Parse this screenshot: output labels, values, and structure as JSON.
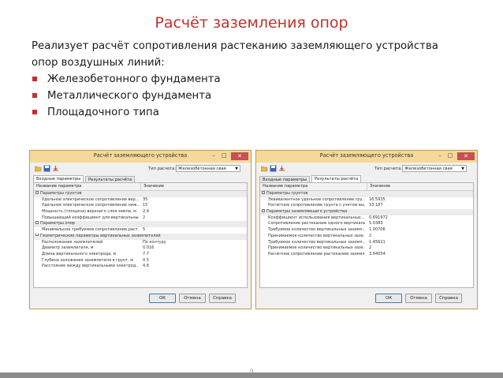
{
  "slide": {
    "title": "Расчёт заземления опор",
    "intro_line1": "Реализует расчёт сопротивления растеканию заземляющего устройства",
    "intro_line2": "опор воздушных линий:",
    "bullets": [
      "Железобетонного фундамента",
      "Металлического фундамента",
      "Площадочного типа"
    ],
    "page_number": "9"
  },
  "colors": {
    "accent": "#c0312a",
    "titlebar": "#f4d99a"
  },
  "left_window": {
    "title": "Расчёт заземляющего устройства",
    "calc_type_label": "Тип расчета:",
    "calc_type_value": "Железобетонная свая",
    "tabs": [
      "Входные параметры",
      "Результаты расчёта"
    ],
    "active_tab": "Входные параметры",
    "col_name": "Название параметра",
    "col_value": "Значение",
    "rows": [
      {
        "name": "Параметры грунтов",
        "value": "",
        "group": true
      },
      {
        "name": "Удельное электрическое сопротивление вер...",
        "value": "35",
        "group": false
      },
      {
        "name": "Удельное электрическое сопротивление ниж...",
        "value": "15",
        "group": false
      },
      {
        "name": "Мощность (толщина) верхнего слоя земли, м",
        "value": "2,9",
        "group": false
      },
      {
        "name": "Повышающий коэффициент для вертикальных ...",
        "value": "2",
        "group": false
      },
      {
        "name": "Параметры опор",
        "value": "",
        "group": true
      },
      {
        "name": "Минимальное требуемое сопротивление раст...",
        "value": "5",
        "group": false
      },
      {
        "name": "Геометрические параметры вертикальных заземлителей",
        "value": "",
        "group": true
      },
      {
        "name": "Расположение заземлителей",
        "value": "По контуру",
        "group": false
      },
      {
        "name": "Диаметр заземлителя, м",
        "value": "0.016",
        "group": false
      },
      {
        "name": "Длина вертикального электрода, м",
        "value": "7.7",
        "group": false
      },
      {
        "name": "Глубина заложения заземлителя в грунт, м",
        "value": "0.5",
        "group": false
      },
      {
        "name": "Расстояние между вертикальными электрод...",
        "value": "4.8",
        "group": false
      }
    ],
    "buttons": {
      "ok": "ОК",
      "cancel": "Отмена",
      "help": "Справка"
    }
  },
  "right_window": {
    "title": "Расчёт заземляющего устройства",
    "calc_type_label": "Тип расчета:",
    "calc_type_value": "Железобетонная свая",
    "tabs": [
      "Входные параметры",
      "Результаты расчёта"
    ],
    "active_tab": "Результаты расчёта",
    "col_name": "Название параметра",
    "col_value": "Значение",
    "rows": [
      {
        "name": "Параметры грунтов",
        "value": "",
        "group": true
      },
      {
        "name": "Эквивалентное удельное сопротивление гру...",
        "value": "16.5935",
        "group": false
      },
      {
        "name": "Расчетное сопротивление грунта с учетом вы...",
        "value": "33.187",
        "group": false
      },
      {
        "name": "Параметры заземляющего устройства",
        "value": "",
        "group": true
      },
      {
        "name": "Коэффициент использования вертикальных...",
        "value": "0.691972",
        "group": false
      },
      {
        "name": "Сопротивление растеканию одного вертикаль...",
        "value": "5.0383",
        "group": false
      },
      {
        "name": "Требуемое количество вертикальных заземл...",
        "value": "1.00706",
        "group": false
      },
      {
        "name": "Принимаемое количество вертикальных зазе...",
        "value": "2",
        "group": false
      },
      {
        "name": "Требуемое количество вертикальных заземл...",
        "value": "1.45621",
        "group": false
      },
      {
        "name": "Принимаемое количество вертикальных зазе...",
        "value": "2",
        "group": false
      },
      {
        "name": "Расчетное сопротивление растеканию заземл...",
        "value": "3.64054",
        "group": false
      }
    ],
    "buttons": {
      "ok": "ОК",
      "cancel": "Отмена",
      "help": "Справка"
    }
  }
}
